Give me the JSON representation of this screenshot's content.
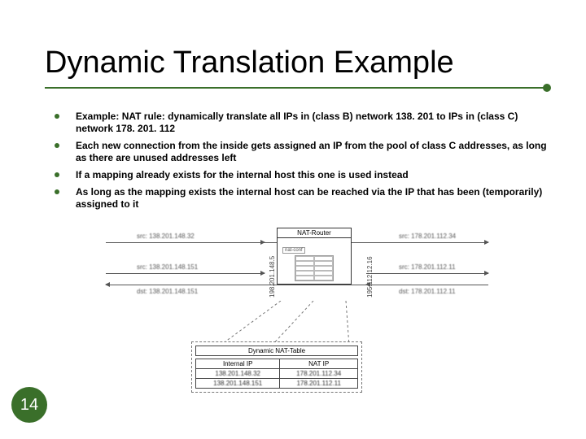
{
  "title": "Dynamic Translation Example",
  "bullets": [
    "Example: NAT rule: dynamically translate all IPs in (class B) network 138. 201 to IPs in (class C) network 178. 201. 112",
    "Each new connection from the inside gets assigned an IP from the pool of class C addresses, as long as there are unused addresses left",
    "If a mapping already exists for the internal host this one is used instead",
    "As long as the mapping exists the internal host can be reached via the IP that has been (temporarily) assigned to it"
  ],
  "diagram": {
    "nat_router_label": "NAT-Router",
    "left_vertical": "198.201.148.5",
    "right_vertical": "195.112.12.16",
    "left_top_arrow": "src: 138.201.148.32",
    "right_top_arrow": "src: 178.201.112.34",
    "left_mid_src": "src: 138.201.148.151",
    "left_mid_dst": "dst: 138.201.148.151",
    "right_mid_src": "src: 178.201.112.11",
    "right_mid_dst": "dst: 178.201.112.11"
  },
  "nat_table": {
    "title": "Dynamic NAT-Table",
    "headers": [
      "Internal IP",
      "NAT IP"
    ],
    "rows": [
      [
        "138.201.148.32",
        "178.201.112.34"
      ],
      [
        "138.201.148.151",
        "178.201.112.11"
      ]
    ]
  },
  "page_number": "14"
}
